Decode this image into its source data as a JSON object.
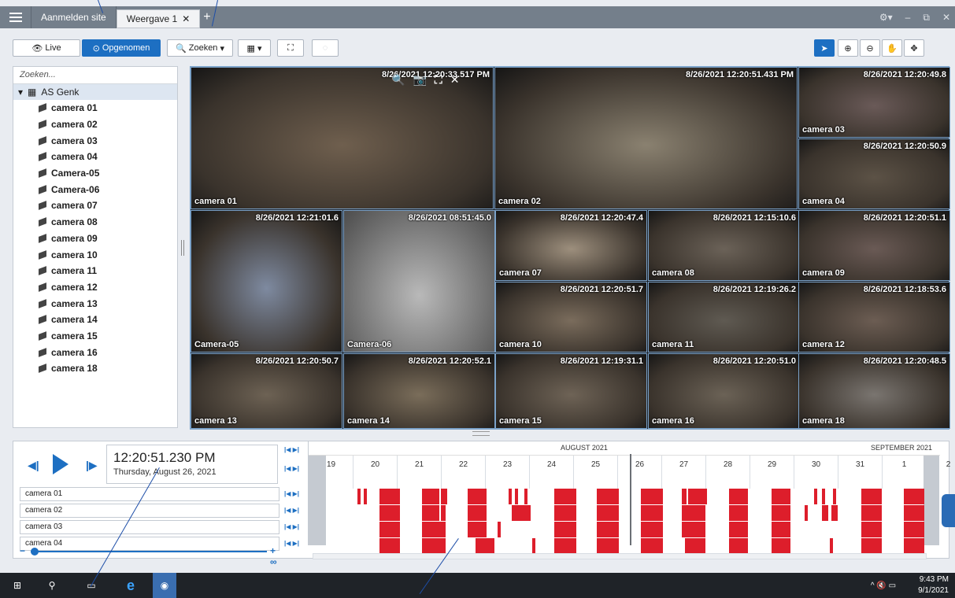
{
  "tabs": [
    {
      "label": "Aanmelden site"
    },
    {
      "label": "Weergave 1"
    }
  ],
  "toolbar": {
    "live_label": "Live",
    "recorded_label": "Opgenomen",
    "search_label": "Zoeken"
  },
  "sidebar": {
    "search_placeholder": "Zoeken...",
    "root_label": "AS Genk",
    "cameras": [
      "camera 01",
      "camera 02",
      "camera 03",
      "camera 04",
      "Camera-05",
      "Camera-06",
      "camera 07",
      "camera 08",
      "camera 09",
      "camera 10",
      "camera 11",
      "camera 12",
      "camera 13",
      "camera 14",
      "camera 15",
      "camera 16",
      "camera 18"
    ]
  },
  "tiles": [
    {
      "timestamp": "8/26/2021 12:20:33.517 PM",
      "label": "camera 01"
    },
    {
      "timestamp": "8/26/2021 12:20:51.431 PM",
      "label": "camera 02"
    },
    {
      "timestamp": "8/26/2021 12:20:49.8",
      "label": "camera 03"
    },
    {
      "timestamp": "8/26/2021 12:20:50.9",
      "label": "camera 04"
    },
    {
      "timestamp": "8/26/2021 12:21:01.6",
      "label": "Camera-05"
    },
    {
      "timestamp": "8/26/2021 08:51:45.0",
      "label": "Camera-06"
    },
    {
      "timestamp": "8/26/2021 12:20:47.4",
      "label": "camera 07"
    },
    {
      "timestamp": "8/26/2021 12:15:10.6",
      "label": "camera 08"
    },
    {
      "timestamp": "8/26/2021 12:20:51.1",
      "label": "camera 09"
    },
    {
      "timestamp": "8/26/2021 12:20:51.7",
      "label": "camera 10"
    },
    {
      "timestamp": "8/26/2021 12:19:26.2",
      "label": "camera 11"
    },
    {
      "timestamp": "8/26/2021 12:18:53.6",
      "label": "camera 12"
    },
    {
      "timestamp": "8/26/2021 12:20:50.7",
      "label": "camera 13"
    },
    {
      "timestamp": "8/26/2021 12:20:52.1",
      "label": "camera 14"
    },
    {
      "timestamp": "8/26/2021 12:19:31.1",
      "label": "camera 15"
    },
    {
      "timestamp": "8/26/2021 12:20:51.0",
      "label": "camera 16"
    },
    {
      "timestamp": "8/26/2021 12:20:48.5",
      "label": "camera 18"
    }
  ],
  "playback": {
    "time": "12:20:51.230 PM",
    "date": "Thursday, August 26, 2021"
  },
  "timeline": {
    "month1": "AUGUST 2021",
    "month2": "SEPTEMBER 2021",
    "days": [
      "19",
      "20",
      "21",
      "22",
      "23",
      "24",
      "25",
      "26",
      "27",
      "28",
      "29",
      "30",
      "31",
      "1",
      "2"
    ],
    "camera_rows": [
      "camera 01",
      "camera 02",
      "camera 03",
      "camera 04"
    ],
    "recording_color": "#dd1e2b"
  },
  "taskbar": {
    "time": "9:43 PM",
    "date": "9/1/2021"
  },
  "colors": {
    "accent": "#1d6fc2",
    "titlebar": "#747f8b"
  }
}
